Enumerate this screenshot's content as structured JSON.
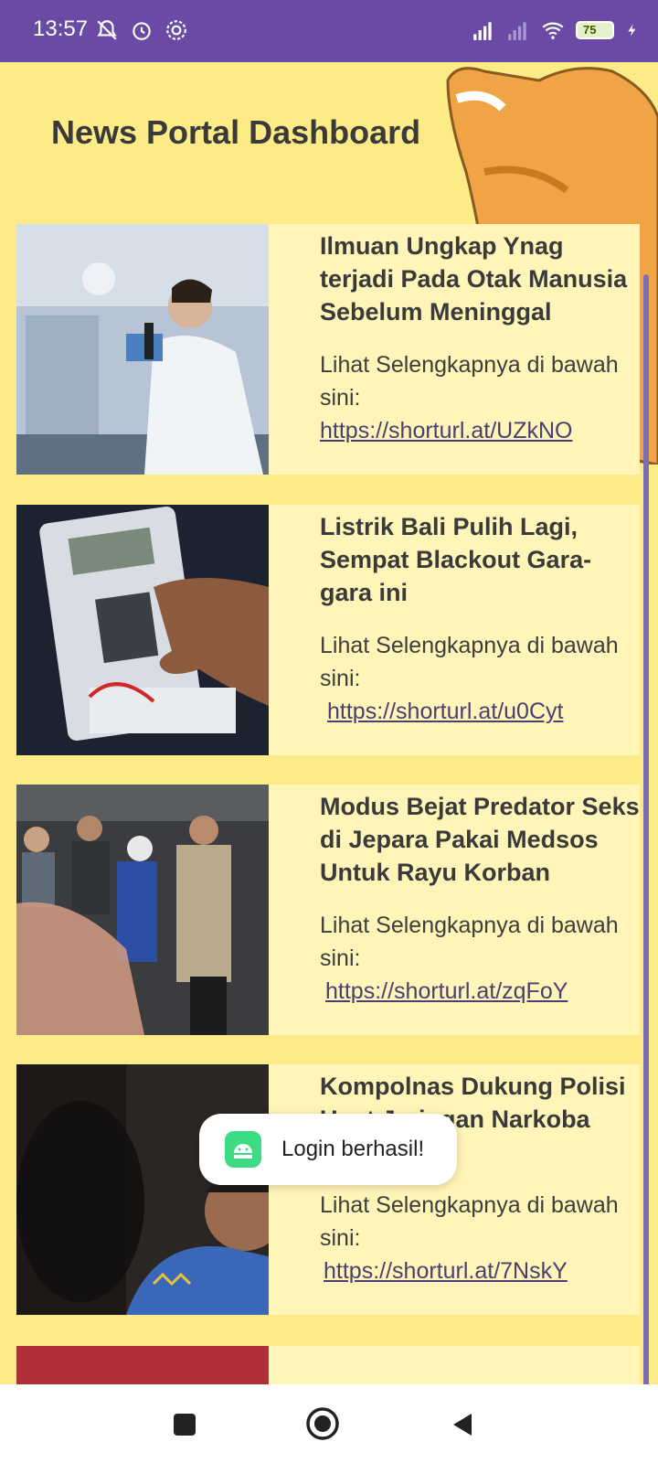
{
  "status_bar": {
    "time": "13:57",
    "battery": "75",
    "icons": [
      "mute-icon",
      "alarm-icon",
      "settings-icon",
      "signal-icon",
      "signal-icon",
      "wifi-icon",
      "battery-icon",
      "charging-icon"
    ]
  },
  "page": {
    "title": "News Portal Dashboard"
  },
  "news": [
    {
      "title": "Ilmuan Ungkap Ynag terjadi Pada Otak Manusia Sebelum Meninggal",
      "desc": "Lihat Selengkapnya di bawah sini:",
      "link": "https://shorturl.at/UZkNO"
    },
    {
      "title": "Listrik Bali Pulih Lagi, Sempat Blackout Gara-gara ini",
      "desc": "Lihat Selengkapnya di bawah sini:",
      "link": "https://shorturl.at/u0Cyt"
    },
    {
      "title": "Modus Bejat Predator Seks di Jepara Pakai Medsos Untuk Rayu Korban",
      "desc": "Lihat Selengkapnya di bawah sini:",
      "link": "https://shorturl.at/zqFoY"
    },
    {
      "title": "Kompolnas Dukung Polisi Usut Jaringan Narkoba soal bisnis",
      "desc": "Lihat Selengkapnya di bawah sini:",
      "link": "https://shorturl.at/7NskY"
    }
  ],
  "toast": {
    "text": "Login berhasil!"
  },
  "colors": {
    "status_bar": "#6a4aa5",
    "background": "#fdeb87",
    "card": "#fff5b8",
    "link": "#4a3f73"
  }
}
